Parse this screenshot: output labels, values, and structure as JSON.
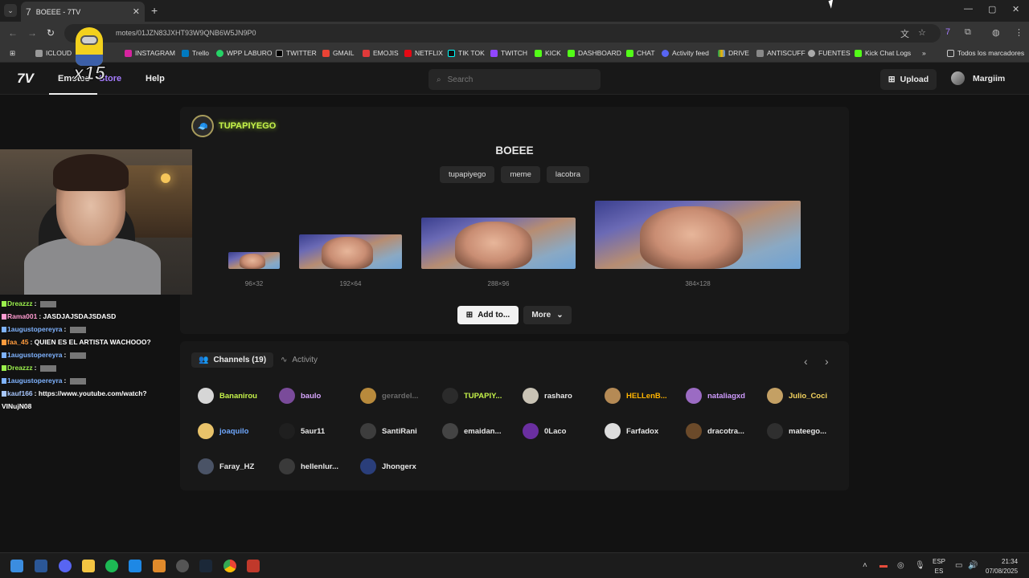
{
  "browser": {
    "tab_title": "BOEEE - 7TV",
    "url": "motes/01JZN83JXHT93W9QNB6W5JN9P0",
    "bookmarks": [
      "ICLOUD",
      "INSTAGRAM",
      "Trello",
      "WPP LABURO",
      "TWITTER",
      "GMAIL",
      "EMOJIS",
      "NETFLIX",
      "TIK TOK",
      "TWITCH",
      "KICK",
      "DASHBOARD",
      "CHAT",
      "Activity feed",
      "DRIVE",
      "ANTISCUFF",
      "FUENTES",
      "Kick Chat Logs",
      "Todos los marcadores"
    ]
  },
  "header": {
    "logo": "7V",
    "nav": {
      "emotes": "Emotes",
      "store": "Store",
      "help": "Help"
    },
    "search_placeholder": "Search",
    "upload_label": "Upload",
    "username": "Margiim"
  },
  "emote": {
    "owner": "TUPAPIYEGO",
    "title": "BOEEE",
    "tags": [
      "tupapiyego",
      "meme",
      "lacobra"
    ],
    "sizes": [
      "96×32",
      "192×64",
      "288×96",
      "384×128"
    ],
    "add_label": "Add to...",
    "more_label": "More"
  },
  "channels": {
    "tab_channels": "Channels (19)",
    "tab_activity": "Activity",
    "list": [
      {
        "name": "Bananirou",
        "color": "#c6f34a"
      },
      {
        "name": "baulo",
        "color": "#d9a6ff"
      },
      {
        "name": "gerardel...",
        "color": "#6b6b6b"
      },
      {
        "name": "TUPAPIY...",
        "color": "#c6f34a"
      },
      {
        "name": "rasharo",
        "color": "#e8e8e8"
      },
      {
        "name": "HELLenB...",
        "color": "#ffb400"
      },
      {
        "name": "nataliagxd",
        "color": "#d09cff"
      },
      {
        "name": "Julio_Coci",
        "color": "#f4d35e"
      },
      {
        "name": "joaquilo",
        "color": "#6fa8ff"
      },
      {
        "name": "5aur11",
        "color": "#e8e8e8"
      },
      {
        "name": "SantiRani",
        "color": "#e8e8e8"
      },
      {
        "name": "emaidan...",
        "color": "#e8e8e8"
      },
      {
        "name": "0Laco",
        "color": "#e8e8e8"
      },
      {
        "name": "Farfadox",
        "color": "#e8e8e8"
      },
      {
        "name": "dracotra...",
        "color": "#e8e8e8"
      },
      {
        "name": "mateego...",
        "color": "#e8e8e8"
      },
      {
        "name": "Faray_HZ",
        "color": "#e8e8e8"
      },
      {
        "name": "hellenlur...",
        "color": "#e8e8e8"
      },
      {
        "name": "Jhongerx",
        "color": "#e8e8e8"
      }
    ]
  },
  "stream": {
    "overlay_text": "x15",
    "chat": [
      {
        "user": "Dreazzz",
        "color": "#9bf04c",
        "msg": ""
      },
      {
        "user": "Rama001",
        "color": "#ff9bd0",
        "msg": "JASDJAJSDAJSDASD"
      },
      {
        "user": "1augustopereyra",
        "color": "#7fb3ff",
        "msg": ""
      },
      {
        "user": "faa_45",
        "color": "#ff9b3d",
        "msg": "QUIEN ES EL ARTISTA WACHOOO?"
      },
      {
        "user": "1augustopereyra",
        "color": "#7fb3ff",
        "msg": ""
      },
      {
        "user": "Dreazzz",
        "color": "#9bf04c",
        "msg": ""
      },
      {
        "user": "1augustopereyra",
        "color": "#7fb3ff",
        "msg": ""
      },
      {
        "user": "kauf166",
        "color": "#a9c8ff",
        "msg": "https://www.youtube.com/watch?"
      },
      {
        "user": "",
        "color": "#ffffff",
        "msg": "VINujN08"
      }
    ]
  },
  "taskbar": {
    "lang_top": "ESP",
    "lang_bottom": "ES",
    "time": "21:34",
    "date": "07/08/2025"
  }
}
